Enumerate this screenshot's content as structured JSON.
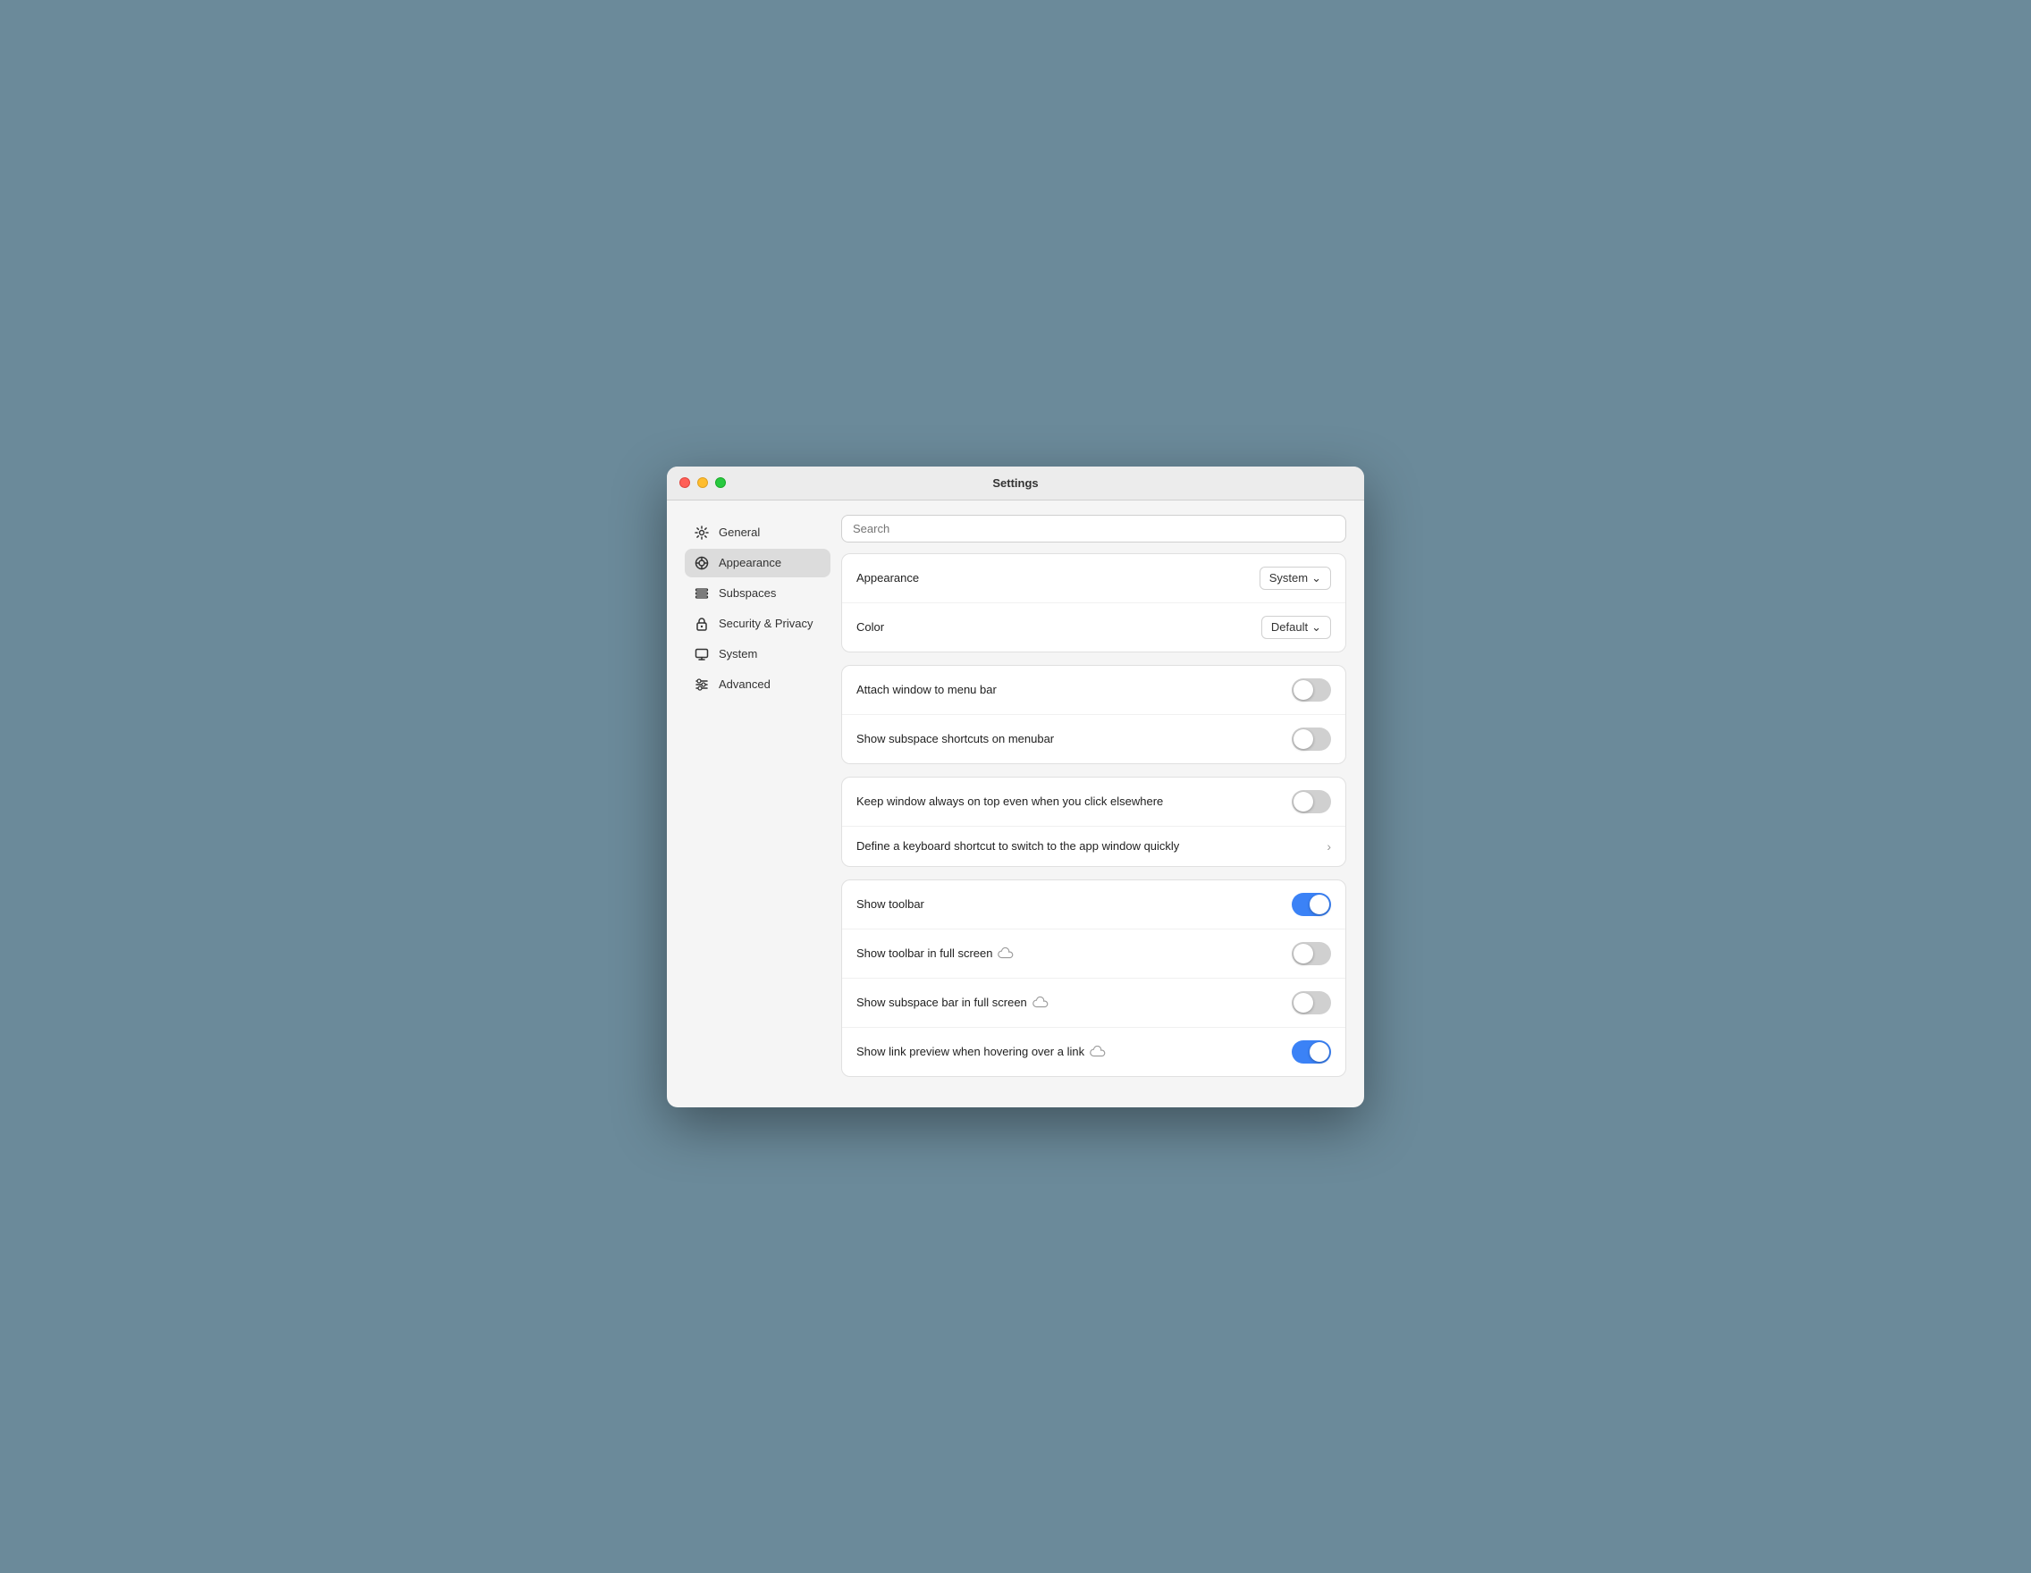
{
  "window": {
    "title": "Settings"
  },
  "search": {
    "placeholder": "Search"
  },
  "sidebar": {
    "items": [
      {
        "id": "general",
        "label": "General",
        "icon": "⚙"
      },
      {
        "id": "appearance",
        "label": "Appearance",
        "icon": "👁",
        "active": true
      },
      {
        "id": "subspaces",
        "label": "Subspaces",
        "icon": "☰"
      },
      {
        "id": "security",
        "label": "Security & Privacy",
        "icon": "🔒"
      },
      {
        "id": "system",
        "label": "System",
        "icon": "🖥"
      },
      {
        "id": "advanced",
        "label": "Advanced",
        "icon": "≡"
      }
    ]
  },
  "sections": {
    "appearance_section": {
      "rows": [
        {
          "id": "appearance",
          "label": "Appearance",
          "control": "dropdown",
          "value": "System"
        },
        {
          "id": "color",
          "label": "Color",
          "control": "dropdown",
          "value": "Default"
        }
      ]
    },
    "window_section": {
      "rows": [
        {
          "id": "attach-window",
          "label": "Attach window to menu bar",
          "control": "toggle",
          "value": false
        },
        {
          "id": "show-subspace-shortcuts",
          "label": "Show subspace shortcuts on menubar",
          "control": "toggle",
          "value": false
        }
      ]
    },
    "behavior_section": {
      "rows": [
        {
          "id": "keep-on-top",
          "label": "Keep window always on top even when you click elsewhere",
          "control": "toggle",
          "value": false
        },
        {
          "id": "keyboard-shortcut",
          "label": "Define a keyboard shortcut to switch to the app window quickly",
          "control": "chevron",
          "value": null
        }
      ]
    },
    "toolbar_section": {
      "rows": [
        {
          "id": "show-toolbar",
          "label": "Show toolbar",
          "control": "toggle",
          "value": true,
          "cloud": false
        },
        {
          "id": "show-toolbar-fullscreen",
          "label": "Show toolbar in full screen",
          "control": "toggle",
          "value": false,
          "cloud": true
        },
        {
          "id": "show-subspace-bar-fullscreen",
          "label": "Show subspace bar in full screen",
          "control": "toggle",
          "value": false,
          "cloud": true
        },
        {
          "id": "show-link-preview",
          "label": "Show link preview when hovering over a link",
          "control": "toggle",
          "value": true,
          "cloud": true
        }
      ]
    }
  },
  "colors": {
    "toggle_on": "#3b82f6",
    "toggle_off": "#d0d0d0"
  }
}
